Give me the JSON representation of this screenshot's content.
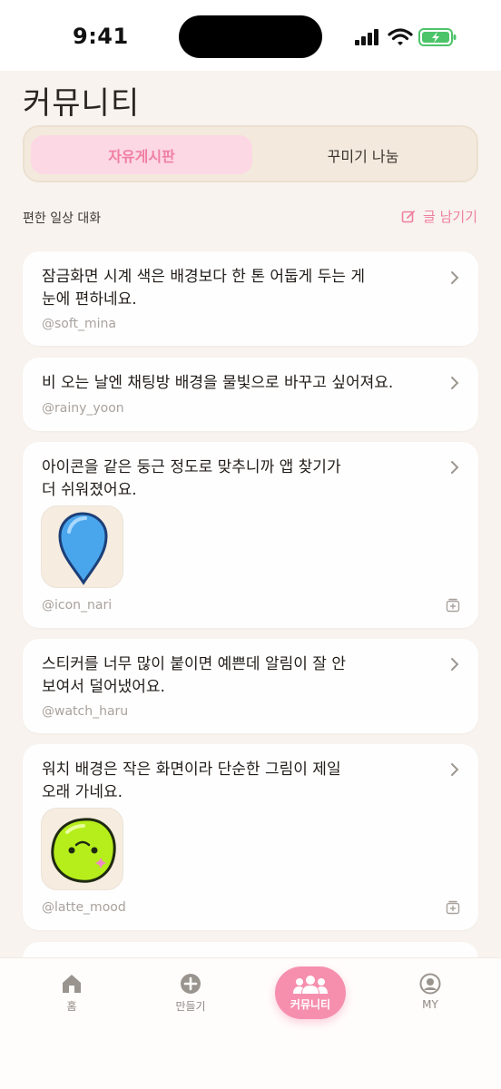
{
  "status_bar": {
    "time": "9:41"
  },
  "page": {
    "title": "커뮤니티"
  },
  "segments": {
    "active": "자유게시판",
    "inactive": "꾸미기 나눔"
  },
  "section": {
    "label": "편한 일상 대화",
    "write_label": "글 남기기"
  },
  "posts": [
    {
      "line1": "잠금화면 시계 색은 배경보다 한 톤 어둡게 두는 게",
      "line2": "눈에 편하네요.",
      "author": "@soft_mina",
      "image": null
    },
    {
      "line1": "비 오는 날엔 채팅방 배경을 물빛으로 바꾸고 싶어져요.",
      "line2": "",
      "author": "@rainy_yoon",
      "image": null
    },
    {
      "line1": "아이콘을 같은 둥근 정도로 맞추니까 앱 찾기가",
      "line2": "더 쉬워졌어요.",
      "author": "@icon_nari",
      "image": "blue-drop-icon"
    },
    {
      "line1": "스티커를 너무 많이 붙이면 예쁜데 알림이 잘 안",
      "line2": "보여서 덜어냈어요.",
      "author": "@watch_haru",
      "image": null
    },
    {
      "line1": "워치 배경은 작은 화면이라 단순한 그림이 제일",
      "line2": "오래 가네요.",
      "author": "@latte_mood",
      "image": "green-face-icon"
    }
  ],
  "tabbar": {
    "home": "홈",
    "create": "만들기",
    "community": "커뮤니티",
    "my": "MY"
  },
  "colors": {
    "accent": "#f68fae",
    "accent_text": "#ef7fa1",
    "background": "#f8f3ee"
  }
}
